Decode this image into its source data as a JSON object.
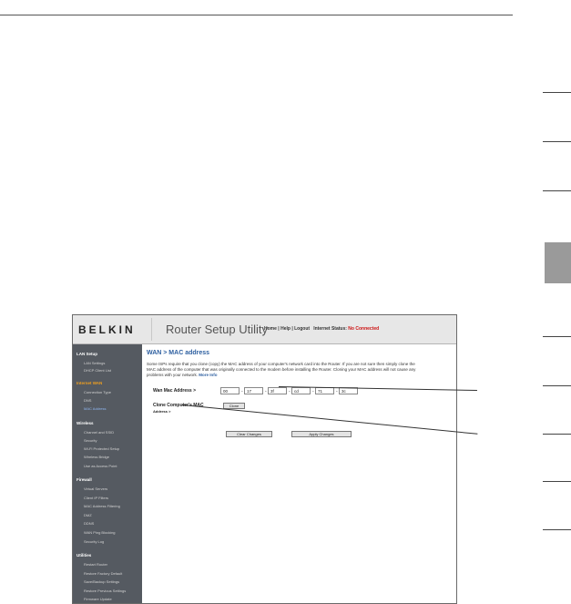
{
  "brand": {
    "logo": "BELKIN",
    "app_title": "Router Setup Utility"
  },
  "top_links": {
    "home": "Home",
    "help": "Help",
    "logout": "Logout",
    "internet_label": "Internet Status:",
    "internet_status": "No Connected"
  },
  "sidebar": {
    "lan": {
      "title": "LAN Setup",
      "items": [
        "LAN Settings",
        "DHCP Client List"
      ]
    },
    "internet": {
      "title": "Internet WAN",
      "items": [
        "Connection Type",
        "DNS",
        "MAC Address"
      ]
    },
    "wireless": {
      "title": "Wireless",
      "items": [
        "Channel and SSID",
        "Security",
        "Wi-Fi Protected Setup",
        "Wireless Bridge",
        "Use as Access Point"
      ]
    },
    "firewall": {
      "title": "Firewall",
      "items": [
        "Virtual Servers",
        "Client IP Filters",
        "MAC Address Filtering",
        "DMZ",
        "DDNS",
        "WAN Ping Blocking",
        "Security Log"
      ]
    },
    "utilities": {
      "title": "Utilities",
      "items": [
        "Restart Router",
        "Restore Factory Default",
        "Save/Backup Settings",
        "Restore Previous Settings",
        "Firmware Update"
      ]
    }
  },
  "main": {
    "title": "WAN > MAC address",
    "description": "Some ISPs require that you clone (copy) the MAC address of your computer's network card into the Router. If you are not sure then simply clone the MAC address of the computer that was originally connected to the modem before installing the Router. Cloning your MAC address will not cause any problems with your network.",
    "more_info": "More Info",
    "wan_mac_label": "Wan Mac Address >",
    "mac_fields": [
      "00",
      "17",
      "3f",
      "cd",
      "71",
      "3c"
    ],
    "clone_label": "Clone Computer's MAC",
    "clone_sublabel": "Address >",
    "clone_button": "Clone",
    "clear_button": "Clear Changes",
    "apply_button": "Apply Changes"
  }
}
